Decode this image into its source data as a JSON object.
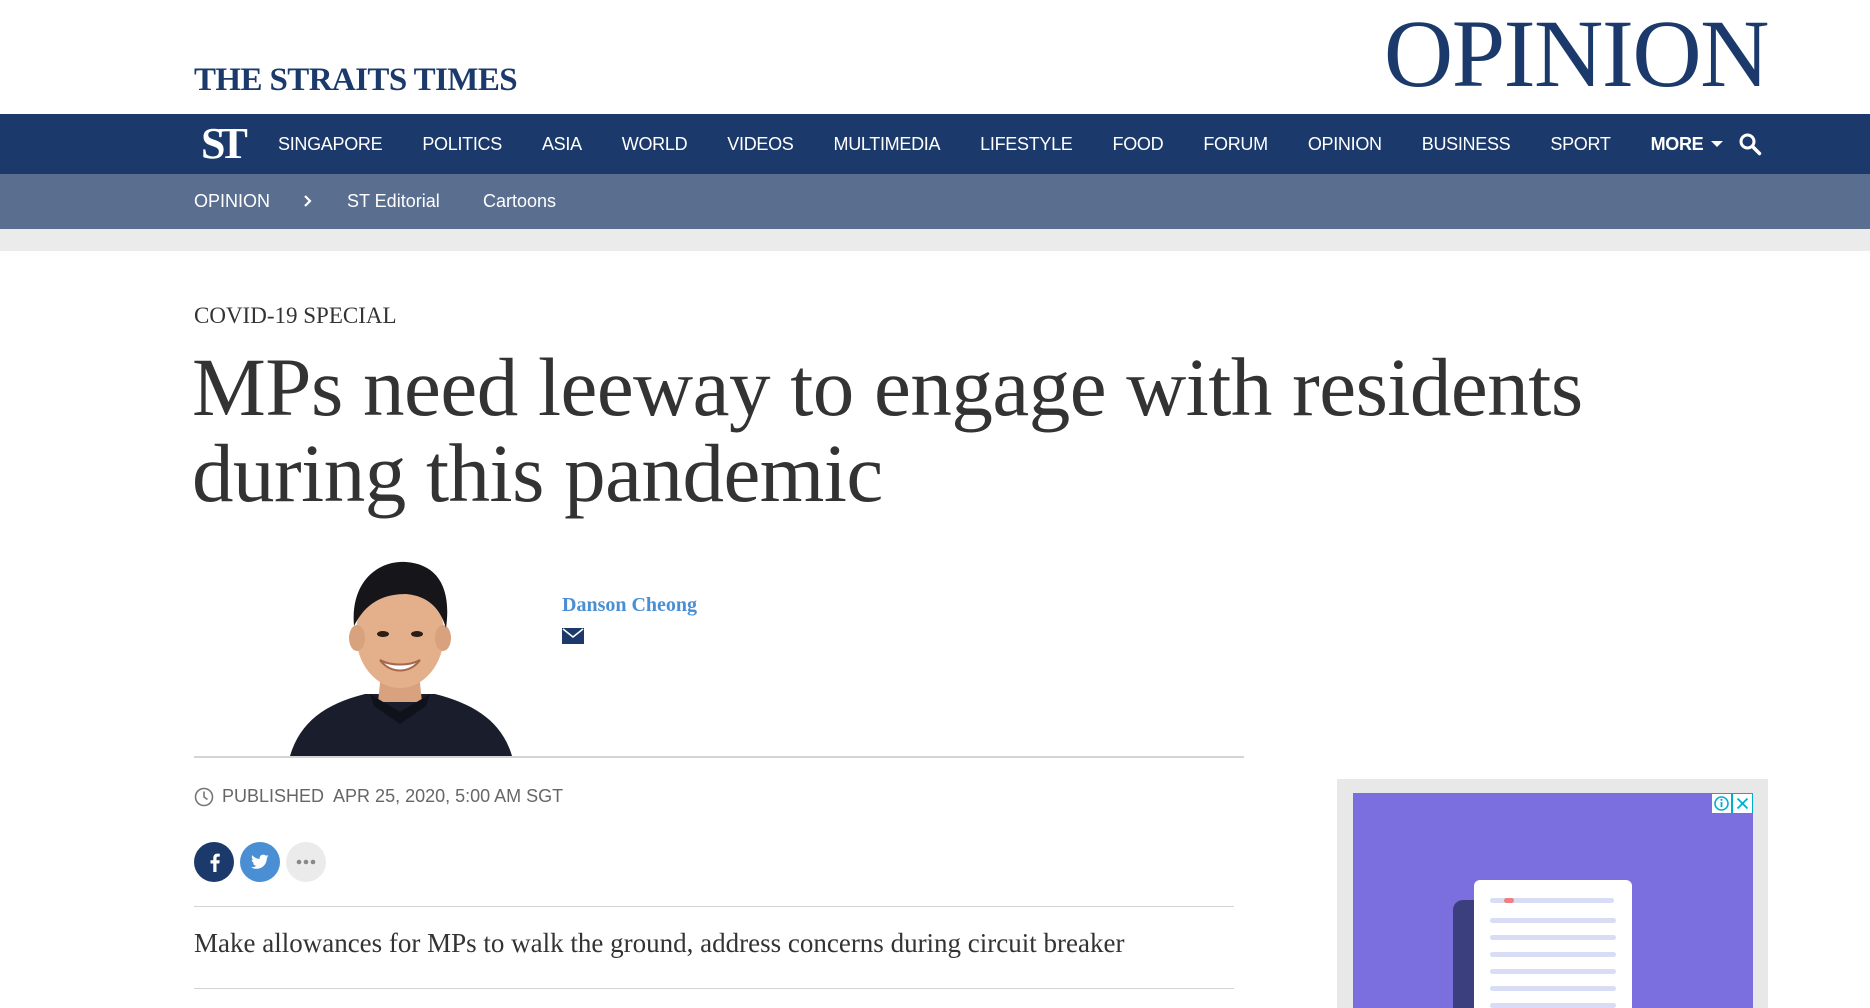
{
  "masthead": {
    "brand": "THE STRAITS TIMES",
    "section_title": "OPINION"
  },
  "primary_nav": {
    "logo": "ST",
    "items": [
      "SINGAPORE",
      "POLITICS",
      "ASIA",
      "WORLD",
      "VIDEOS",
      "MULTIMEDIA",
      "LIFESTYLE",
      "FOOD",
      "FORUM",
      "OPINION",
      "BUSINESS",
      "SPORT"
    ],
    "more_label": "MORE",
    "search_icon": "search-icon"
  },
  "secondary_nav": {
    "section": "OPINION",
    "items": [
      "ST Editorial",
      "Cartoons"
    ]
  },
  "article": {
    "kicker": "COVID-19 SPECIAL",
    "headline": "MPs need leeway to engage with residents during this pandemic",
    "author": "Danson Cheong",
    "published_label": "PUBLISHED",
    "published_date": "APR 25, 2020, 5:00 AM SGT",
    "standfirst": "Make allowances for MPs to walk the ground, address concerns during circuit breaker"
  },
  "share": {
    "icons": [
      "facebook-icon",
      "twitter-icon",
      "more-icon"
    ]
  },
  "colors": {
    "brand_navy": "#1b3a6b",
    "subnav": "#5a6e90",
    "author_link": "#4a8fd4",
    "ad_purple": "#7b6fe0"
  }
}
